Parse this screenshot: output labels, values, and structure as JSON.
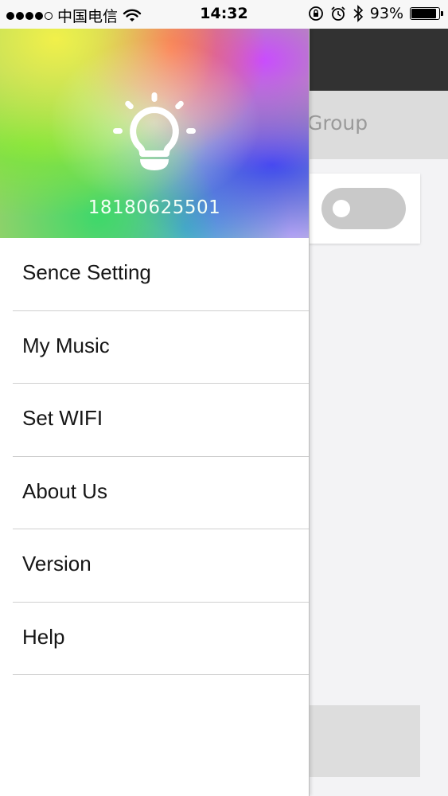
{
  "status_bar": {
    "carrier": "中国电信",
    "time": "14:32",
    "battery_percent_text": "93%",
    "battery_level": 0.93,
    "icons": [
      "signal-dots-icon",
      "wifi-icon",
      "orientation-lock-icon",
      "alarm-icon",
      "bluetooth-icon",
      "battery-icon"
    ]
  },
  "background_app": {
    "tab_label": "Group",
    "toggle_state": "off",
    "colors": {
      "nav_bar": "#323232",
      "tab_bar": "#dcdcdc",
      "toggle_off": "#c9c9c9"
    }
  },
  "drawer": {
    "header": {
      "icon": "lightbulb-icon",
      "phone_number": "18180625501"
    },
    "menu": [
      {
        "label": "Sence Setting"
      },
      {
        "label": "My Music"
      },
      {
        "label": "Set WIFI"
      },
      {
        "label": "About Us"
      },
      {
        "label": "Version"
      },
      {
        "label": "Help"
      }
    ]
  }
}
